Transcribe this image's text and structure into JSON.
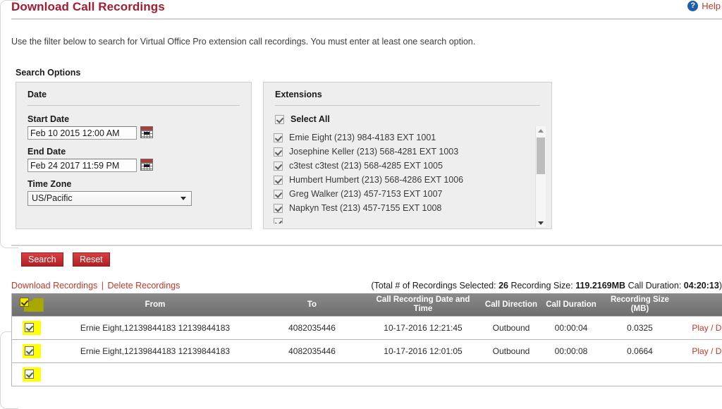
{
  "header": {
    "title": "Download Call Recordings",
    "help_label": "Help",
    "help_icon": "question-circle-icon"
  },
  "intro": "Use the filter below to search for Virtual Office Pro extension call recordings. You must enter at least one search option.",
  "search_options": {
    "section_label": "Search Options",
    "date_panel": {
      "title": "Date",
      "start_date_label": "Start Date",
      "start_date_value": "Feb 10 2015 12:00 AM",
      "end_date_label": "End Date",
      "end_date_value": "Feb 24 2017 11:59 PM",
      "time_zone_label": "Time Zone",
      "time_zone_value": "US/Pacific",
      "calendar_icon": "calendar-icon",
      "dropdown_icon": "chevron-down-icon"
    },
    "extensions_panel": {
      "title": "Extensions",
      "select_all_label": "Select All",
      "select_all_checked": true,
      "items": [
        {
          "label": "Emie Eight (213) 984-4183 EXT 1001",
          "checked": true
        },
        {
          "label": "Josephine Keller (213) 568-4281 EXT 1003",
          "checked": true
        },
        {
          "label": "c3test c3test (213) 568-4285 EXT 1005",
          "checked": true
        },
        {
          "label": "Humbert Humbert (213) 568-4286 EXT 1006",
          "checked": true
        },
        {
          "label": "Greg Walker (213) 457-7153 EXT 1007",
          "checked": true
        },
        {
          "label": "Napkyn Test (213) 457-7155 EXT 1008",
          "checked": true
        }
      ],
      "scrollbar_up_icon": "triangle-up-icon",
      "scrollbar_down_icon": "triangle-down-icon"
    }
  },
  "actions": {
    "search_label": "Search",
    "reset_label": "Reset"
  },
  "links": {
    "download_recordings": "Download Recordings",
    "separator": "|",
    "delete_recordings": "Delete Recordings"
  },
  "totals": {
    "prefix": "(Total # of Recordings Selected:",
    "count": "26",
    "size_label": "Recording Size:",
    "size_value": "119.2169MB",
    "duration_label": "Call Duration:",
    "duration_value": "04:20:13",
    "suffix": ")"
  },
  "table": {
    "columns": [
      "",
      "From",
      "To",
      "Call Recording Date and Time",
      "Call Direction",
      "Call Duration",
      "Recording Size (MB)",
      ""
    ],
    "header_select_all_checked": true,
    "header_folder_icon": "folder-icon",
    "rows": [
      {
        "checked": true,
        "from": "Ernie Eight,12139844183 12139844183",
        "to": "4082035446",
        "datetime": "10-17-2016 12:21:45",
        "direction": "Outbound",
        "duration": "00:00:04",
        "size": "0.0325",
        "action": "Play / Download"
      },
      {
        "checked": true,
        "from": "Ernie Eight,12139844183 12139844183",
        "to": "4082035446",
        "datetime": "10-17-2016 12:01:05",
        "direction": "Outbound",
        "duration": "00:00:08",
        "size": "0.0664",
        "action": "Play / Download"
      }
    ]
  },
  "colors": {
    "title_red": "#a51c30",
    "link_red": "#c0392b",
    "button_red": "#b11f26",
    "header_gray": "#6e6e6e",
    "highlight_yellow": "#ffff00",
    "help_blue": "#1f5fa9"
  }
}
